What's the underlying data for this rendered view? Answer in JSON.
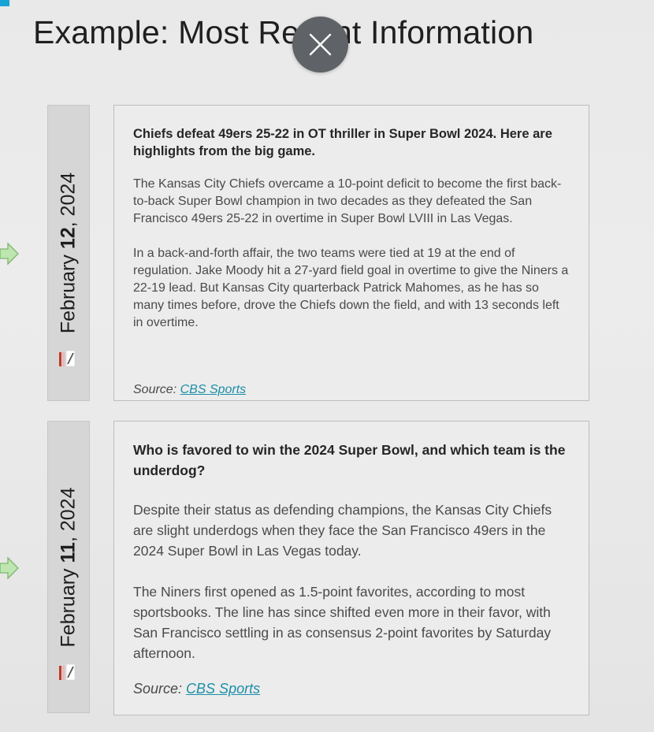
{
  "slide": {
    "title": "Example: Most Recent Information"
  },
  "colors": {
    "accent_corner": "#16a4d8",
    "link": "#1b8ea8",
    "close_button_bg": "#5f6266",
    "arrow_fill": "#bde6b0",
    "arrow_stroke": "#7fb56e"
  },
  "entries": [
    {
      "date_month": "February",
      "date_day": "12",
      "date_year": ", 2024",
      "headline": "Chiefs defeat 49ers 25-22 in OT thriller in Super Bowl 2024. Here are highlights from the big game.",
      "paragraphs": [
        "The Kansas City Chiefs overcame a 10-point deficit to become the first back-to-back Super Bowl champion in two decades as they defeated the San Francisco 49ers 25-22 in overtime in Super Bowl LVIII in Las Vegas.",
        "In a back-and-forth affair, the two teams were tied at 19 at the end of regulation. Jake Moody hit a 27-yard field goal in overtime to give the Niners a 22-19 lead. But Kansas City quarterback Patrick Mahomes, as he has so many times before, drove the Chiefs down the field, and with 13 seconds left in overtime."
      ],
      "source_label": "Source: ",
      "source_link": "CBS Sports"
    },
    {
      "date_month": "February",
      "date_day": "11",
      "date_year": ", 2024",
      "headline": "Who is favored to win the 2024 Super Bowl, and which team is the underdog?",
      "paragraphs": [
        "Despite their status as defending champions, the Kansas City Chiefs are slight underdogs when they face the San Francisco 49ers in the 2024 Super Bowl in Las Vegas today.",
        "The Niners first opened as 1.5-point favorites, according to most sportsbooks. The line has since shifted even more in their favor, with San Francisco settling in as consensus 2-point favorites by Saturday afternoon."
      ],
      "source_label": "Source: ",
      "source_link": "CBS Sports"
    }
  ]
}
